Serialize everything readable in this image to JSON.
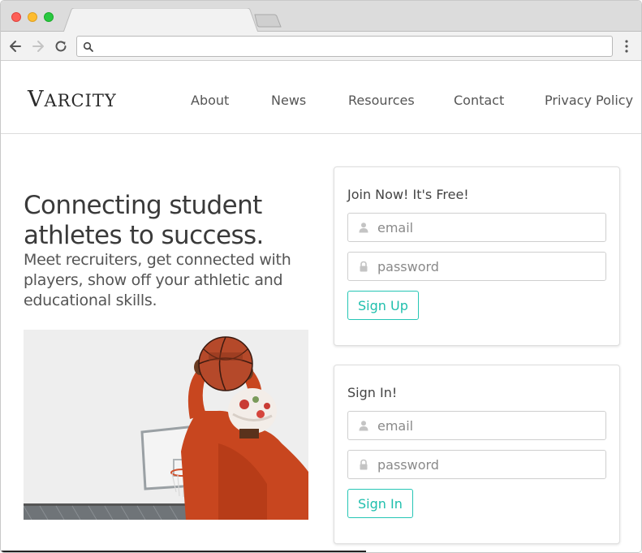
{
  "browser": {
    "address_value": "",
    "icons": {
      "back": "arrow-left-icon",
      "forward": "arrow-right-icon",
      "reload": "reload-icon",
      "search": "search-icon",
      "menu": "more-vertical-icon"
    }
  },
  "site": {
    "logo": {
      "first": "V",
      "rest": "ARCITY"
    },
    "nav": [
      "About",
      "News",
      "Resources",
      "Contact",
      "Privacy Policy"
    ]
  },
  "hero": {
    "title_line1": "Connecting student",
    "title_line2": "athletes to success.",
    "subtitle": "Meet recruiters, get connected with players, show off your athletic and educational skills.",
    "image": "basketball-player-shooting-photo"
  },
  "join": {
    "title": "Join Now! It's Free!",
    "email_placeholder": "email",
    "password_placeholder": "password",
    "button_label": "Sign Up"
  },
  "signin": {
    "title": "Sign In!",
    "email_placeholder": "email",
    "password_placeholder": "password",
    "button_label": "Sign In"
  },
  "colors": {
    "accent": "#1fbfad",
    "text_dark": "#3a3a3a",
    "text_muted": "#555555"
  }
}
